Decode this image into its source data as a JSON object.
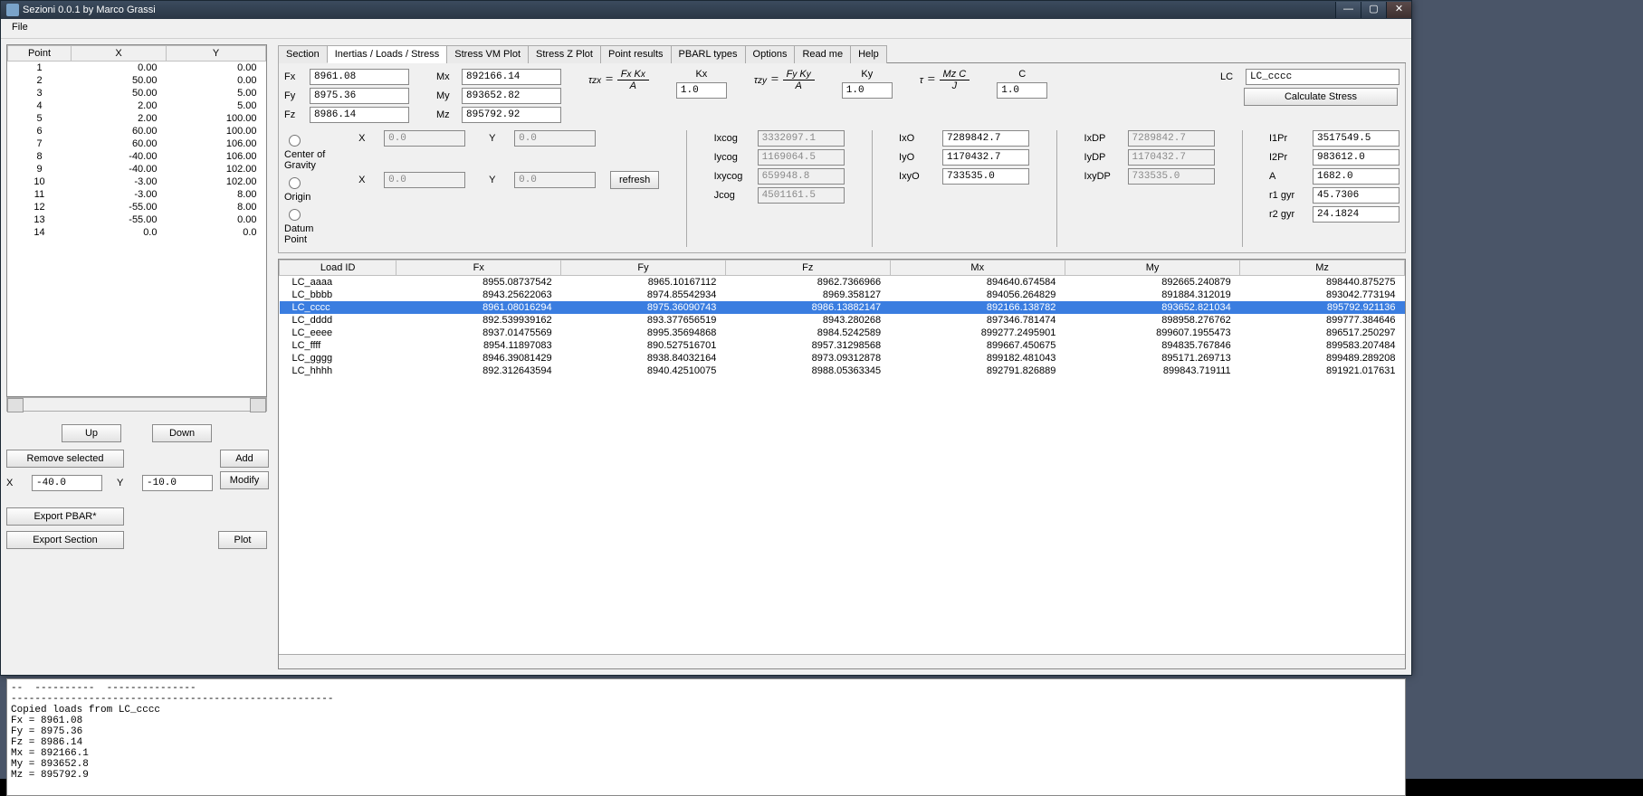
{
  "window": {
    "title": "Sezioni 0.0.1 by Marco Grassi",
    "menu": {
      "file": "File"
    }
  },
  "tabs": [
    "Section",
    "Inertias / Loads / Stress",
    "Stress VM Plot",
    "Stress Z Plot",
    "Point results",
    "PBARL types",
    "Options",
    "Read me",
    "Help"
  ],
  "active_tab": 1,
  "points": {
    "headers": [
      "Point",
      "X",
      "Y"
    ],
    "rows": [
      [
        "1",
        "0.00",
        "0.00"
      ],
      [
        "2",
        "50.00",
        "0.00"
      ],
      [
        "3",
        "50.00",
        "5.00"
      ],
      [
        "4",
        "2.00",
        "5.00"
      ],
      [
        "5",
        "2.00",
        "100.00"
      ],
      [
        "6",
        "60.00",
        "100.00"
      ],
      [
        "7",
        "60.00",
        "106.00"
      ],
      [
        "8",
        "-40.00",
        "106.00"
      ],
      [
        "9",
        "-40.00",
        "102.00"
      ],
      [
        "10",
        "-3.00",
        "102.00"
      ],
      [
        "11",
        "-3.00",
        "8.00"
      ],
      [
        "12",
        "-55.00",
        "8.00"
      ],
      [
        "13",
        "-55.00",
        "0.00"
      ],
      [
        "14",
        "0.0",
        "0.0"
      ]
    ]
  },
  "left_buttons": {
    "up": "Up",
    "down": "Down",
    "remove": "Remove selected",
    "add": "Add",
    "modify": "Modify",
    "export_pbar": "Export PBAR*",
    "export_section": "Export Section",
    "plot": "Plot",
    "x_label": "X",
    "y_label": "Y",
    "x_val": "-40.0",
    "y_val": "-10.0"
  },
  "forces": {
    "Fx": {
      "label": "Fx",
      "value": "8961.08"
    },
    "Fy": {
      "label": "Fy",
      "value": "8975.36"
    },
    "Fz": {
      "label": "Fz",
      "value": "8986.14"
    },
    "Mx": {
      "label": "Mx",
      "value": "892166.14"
    },
    "My": {
      "label": "My",
      "value": "893652.82"
    },
    "Mz": {
      "label": "Mz",
      "value": "895792.92"
    }
  },
  "reference": {
    "cog": "Center of Gravity",
    "origin": "Origin",
    "datum": "Datum Point",
    "X": "X",
    "Y": "Y",
    "x1": "0.0",
    "y1": "0.0",
    "x2": "0.0",
    "y2": "0.0",
    "refresh": "refresh"
  },
  "factors": {
    "Kx": {
      "label": "Kx",
      "value": "1.0"
    },
    "Ky": {
      "label": "Ky",
      "value": "1.0"
    },
    "C": {
      "label": "C",
      "value": "1.0"
    }
  },
  "lc": {
    "label": "LC",
    "value": "LC_cccc",
    "calc": "Calculate Stress"
  },
  "cog_vals": {
    "Ixcog": {
      "label": "Ixcog",
      "value": "3332097.1"
    },
    "Iycog": {
      "label": "Iycog",
      "value": "1169064.5"
    },
    "Ixycog": {
      "label": "Ixycog",
      "value": "659948.8"
    },
    "Jcog": {
      "label": "Jcog",
      "value": "4501161.5"
    }
  },
  "o_vals": {
    "IxO": {
      "label": "IxO",
      "value": "7289842.7"
    },
    "IyO": {
      "label": "IyO",
      "value": "1170432.7"
    },
    "IxyO": {
      "label": "IxyO",
      "value": "733535.0"
    }
  },
  "dp_vals": {
    "IxDP": {
      "label": "IxDP",
      "value": "7289842.7"
    },
    "IyDP": {
      "label": "IyDP",
      "value": "1170432.7"
    },
    "IxyDP": {
      "label": "IxyDP",
      "value": "733535.0"
    }
  },
  "props": {
    "I1Pr": {
      "label": "I1Pr",
      "value": "3517549.5"
    },
    "I2Pr": {
      "label": "I2Pr",
      "value": "983612.0"
    },
    "A": {
      "label": "A",
      "value": "1682.0"
    },
    "r1gyr": {
      "label": "r1 gyr",
      "value": "45.7306"
    },
    "r2gyr": {
      "label": "r2 gyr",
      "value": "24.1824"
    }
  },
  "load_table": {
    "headers": [
      "Load ID",
      "Fx",
      "Fy",
      "Fz",
      "Mx",
      "My",
      "Mz"
    ],
    "rows": [
      {
        "id": "LC_aaaa",
        "Fx": "8955.08737542",
        "Fy": "8965.10167112",
        "Fz": "8962.7366966",
        "Mx": "894640.674584",
        "My": "892665.240879",
        "Mz": "898440.875275"
      },
      {
        "id": "LC_bbbb",
        "Fx": "8943.25622063",
        "Fy": "8974.85542934",
        "Fz": "8969.358127",
        "Mx": "894056.264829",
        "My": "891884.312019",
        "Mz": "893042.773194"
      },
      {
        "id": "LC_cccc",
        "Fx": "8961.08016294",
        "Fy": "8975.36090743",
        "Fz": "8986.13882147",
        "Mx": "892166.138782",
        "My": "893652.821034",
        "Mz": "895792.921136",
        "selected": true
      },
      {
        "id": "LC_dddd",
        "Fx": "892.539939162",
        "Fy": "893.377656519",
        "Fz": "8943.280268",
        "Mx": "897346.781474",
        "My": "898958.276762",
        "Mz": "899777.384646"
      },
      {
        "id": "LC_eeee",
        "Fx": "8937.01475569",
        "Fy": "8995.35694868",
        "Fz": "8984.5242589",
        "Mx": "899277.2495901",
        "My": "899607.1955473",
        "Mz": "896517.250297"
      },
      {
        "id": "LC_ffff",
        "Fx": "8954.11897083",
        "Fy": "890.527516701",
        "Fz": "8957.31298568",
        "Mx": "899667.450675",
        "My": "894835.767846",
        "Mz": "899583.207484"
      },
      {
        "id": "LC_gggg",
        "Fx": "8946.39081429",
        "Fy": "8938.84032164",
        "Fz": "8973.09312878",
        "Mx": "899182.481043",
        "My": "895171.269713",
        "Mz": "899489.289208"
      },
      {
        "id": "LC_hhhh",
        "Fx": "892.312643594",
        "Fy": "8940.42510075",
        "Fz": "8988.05363345",
        "Mx": "892791.826889",
        "My": "899843.719111",
        "Mz": "891921.017631"
      }
    ]
  },
  "log": "--  ----------  ---------------\n------------------------------------------------------\nCopied loads from LC_cccc\nFx = 8961.08\nFy = 8975.36\nFz = 8986.14\nMx = 892166.1\nMy = 893652.8\nMz = 895792.9"
}
